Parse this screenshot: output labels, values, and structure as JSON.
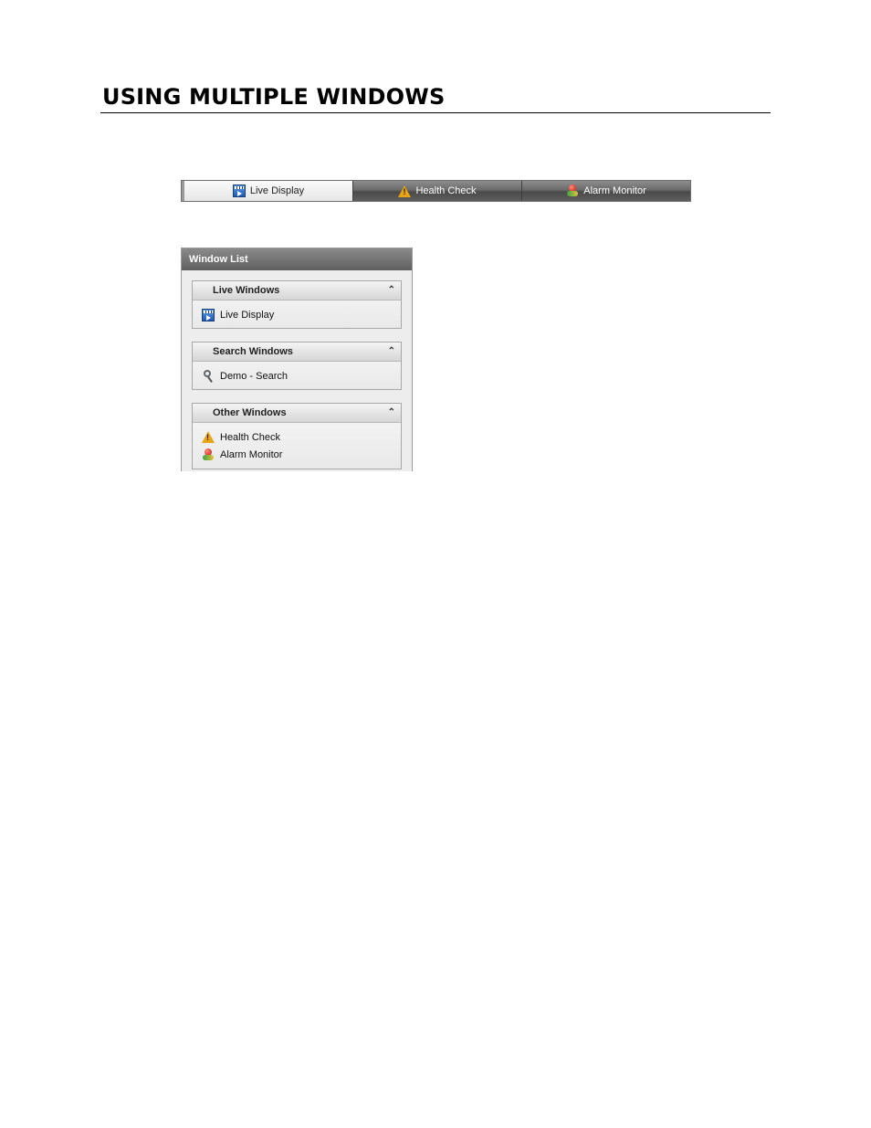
{
  "page": {
    "title": "USING MULTIPLE WINDOWS"
  },
  "tabs": [
    {
      "label": "Live Display",
      "icon": "live-display-icon",
      "active": true
    },
    {
      "label": "Health Check",
      "icon": "health-check-icon",
      "active": false
    },
    {
      "label": "Alarm Monitor",
      "icon": "alarm-monitor-icon",
      "active": false
    }
  ],
  "window_list": {
    "title": "Window List",
    "groups": [
      {
        "header": "Live Windows",
        "items": [
          {
            "label": "Live Display",
            "icon": "live-display-icon"
          }
        ]
      },
      {
        "header": "Search Windows",
        "items": [
          {
            "label": "Demo - Search",
            "icon": "search-icon"
          }
        ]
      },
      {
        "header": "Other Windows",
        "items": [
          {
            "label": "Health Check",
            "icon": "health-check-icon"
          },
          {
            "label": "Alarm Monitor",
            "icon": "alarm-monitor-icon"
          }
        ]
      }
    ],
    "collapse_glyph": "⌃"
  },
  "colors": {
    "tab_inactive": "#5e5e5e",
    "tab_active": "#e6e6e6",
    "panel_header": "#707070",
    "panel_bg": "#ededed"
  }
}
